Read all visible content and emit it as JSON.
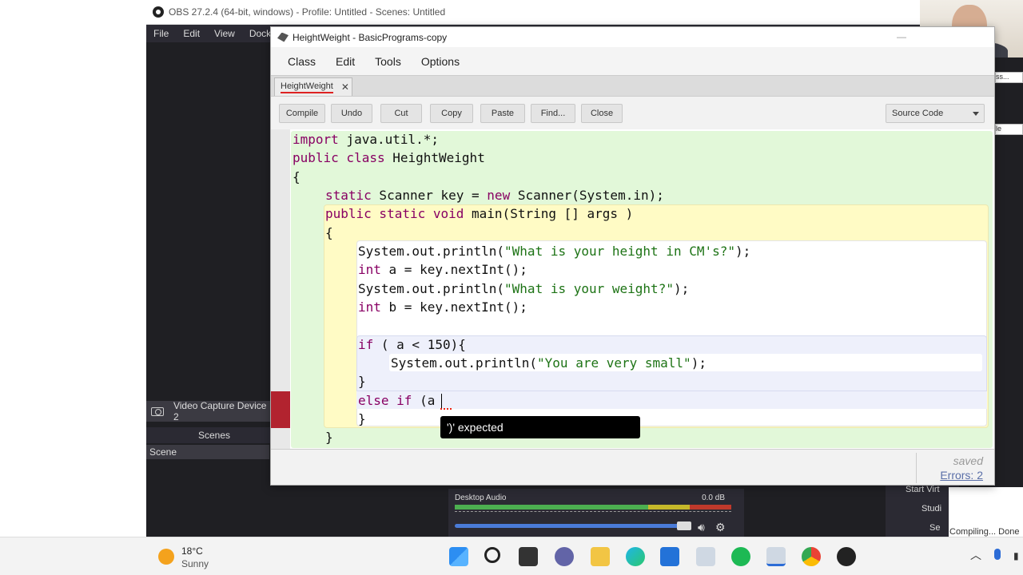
{
  "obs": {
    "title": "OBS 27.2.4 (64-bit, windows) - Profile: Untitled - Scenes: Untitled",
    "menu": [
      "File",
      "Edit",
      "View",
      "Docks"
    ],
    "source_item": "Video Capture Device 2",
    "scenes_header": "Scenes",
    "scene_item": "Scene",
    "mixer": {
      "label": "Desktop Audio",
      "db": "0.0 dB"
    },
    "controls": [
      "Start Virt",
      "Studi",
      "Se"
    ],
    "status": "Compiling... Done",
    "edge_labels": [
      "ss...",
      "le"
    ]
  },
  "bluej": {
    "title": "HeightWeight - BasicPrograms-copy",
    "menu": [
      "Class",
      "Edit",
      "Tools",
      "Options"
    ],
    "tab_label": "HeightWeight",
    "toolbar": {
      "compile": "Compile",
      "undo": "Undo",
      "cut": "Cut",
      "copy": "Copy",
      "paste": "Paste",
      "find": "Find...",
      "close": "Close",
      "view_select": "Source Code"
    },
    "code": {
      "l1_kw": "import",
      "l1_rest": " java.util.*;",
      "l2_kw": "public class",
      "l2_rest": " HeightWeight",
      "l3": "{",
      "l4_kw1": "static",
      "l4_mid": " Scanner key = ",
      "l4_kw2": "new",
      "l4_rest": " Scanner(System.in);",
      "l5_kw": "public static void",
      "l5_rest": " main(String [] args )",
      "l6": "{",
      "l7_pre": "System.out.println(",
      "l7_str": "\"What is your height in CM's?\"",
      "l7_post": ");",
      "l8_kw": "int",
      "l8_rest": " a = key.nextInt();",
      "l9_pre": "System.out.println(",
      "l9_str": "\"What is your weight?\"",
      "l9_post": ");",
      "l10_kw": "int",
      "l10_rest": " b = key.nextInt();",
      "l11_kw": "if",
      "l11_rest": " ( a < 150){",
      "l12_pre": "System.out.println(",
      "l12_str": "\"You are very small\"",
      "l12_post": ");",
      "l13": "}",
      "l14_kw": "else if",
      "l14_rest": " (a",
      "l15": "}",
      "l16": "}"
    },
    "error_popup": "')' expected",
    "status_saved": "saved",
    "status_errors": "Errors: 2"
  },
  "taskbar": {
    "weather_temp": "18°C",
    "weather_desc": "Sunny",
    "apps": [
      "windows-start",
      "search",
      "task-view",
      "teams-chat",
      "file-explorer",
      "edge",
      "store",
      "bluej",
      "spotify",
      "bluej-active",
      "chrome",
      "github"
    ]
  }
}
